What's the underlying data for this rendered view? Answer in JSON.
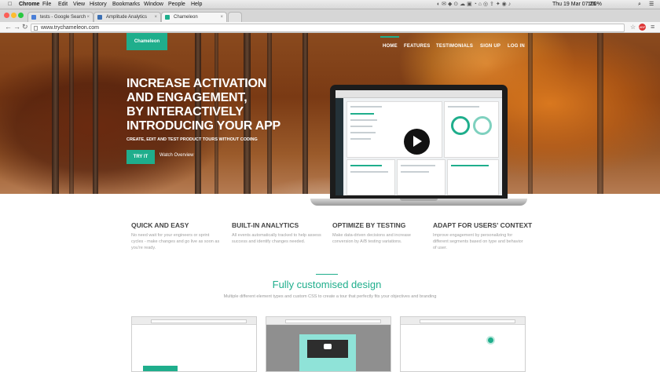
{
  "os_menu": {
    "apple": "",
    "items": [
      "Chrome",
      "File",
      "Edit",
      "View",
      "History",
      "Bookmarks",
      "Window",
      "People",
      "Help"
    ],
    "clock": "Thu 19 Mar  07:26",
    "battery": "100%"
  },
  "tabs": [
    {
      "label": "tests - Google Search",
      "favicon_color": "#4a7fd8"
    },
    {
      "label": "Amplitude Analytics",
      "favicon_color": "#3b6fb3"
    },
    {
      "label": "Chameleon",
      "favicon_color": "#1fae8c"
    }
  ],
  "omnibox": {
    "url": "www.trychameleon.com"
  },
  "page": {
    "brand": "Chameleon",
    "nav": [
      "HOME",
      "FEATURES",
      "TESTIMONIALS",
      "SIGN UP",
      "LOG IN"
    ],
    "headline": [
      "INCREASE ACTIVATION",
      "AND ENGAGEMENT,",
      "BY INTERACTIVELY",
      "INTRODUCING YOUR APP"
    ],
    "subhead": "CREATE, EDIT AND TEST PRODUCT TOURS WITHOUT CODING",
    "cta": "TRY IT",
    "watch": "Watch Overview",
    "features": [
      {
        "title": "QUICK AND EASY",
        "desc": "No need wait for your engineers or sprint cycles - make changes and go live as soon as you're ready."
      },
      {
        "title": "BUILT-IN ANALYTICS",
        "desc": "All events automatically tracked to help assess success and identify changes needed."
      },
      {
        "title": "OPTIMIZE BY TESTING",
        "desc": "Make data-driven decisions and increase conversion by A/B testing variations."
      },
      {
        "title": "ADAPT FOR USERS' CONTEXT",
        "desc": "Improve engagement by personalizing for different segments based on type and behavior of user."
      }
    ],
    "custom_title": "Fully customised design",
    "custom_sub": "Multiple different element types and custom CSS to create a tour that perfectly fits your objectives and branding"
  },
  "colors": {
    "accent": "#1fae8c"
  }
}
